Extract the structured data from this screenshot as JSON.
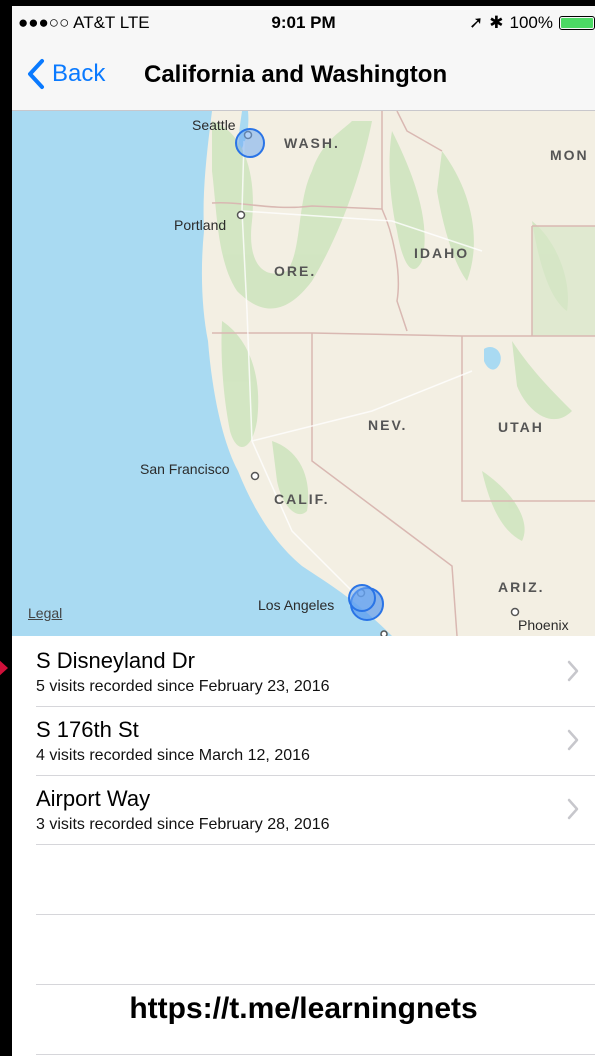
{
  "status_bar": {
    "carrier": "●●●○○ AT&T  LTE",
    "time": "9:01 PM",
    "battery": "100%",
    "battery_color": "#4cd964"
  },
  "nav": {
    "back_label": "Back",
    "title": "California and Washington",
    "accent": "#0a7aff"
  },
  "map": {
    "legal": "Legal",
    "cities": {
      "seattle": "Seattle",
      "portland": "Portland",
      "san_francisco": "San Francisco",
      "los_angeles": "Los Angeles",
      "phoenix": "Phoenix"
    },
    "states": {
      "wash": "WASH.",
      "ore": "ORE.",
      "idaho": "IDAHO",
      "mon": "MON",
      "nev": "NEV.",
      "utah": "UTAH",
      "calif": "CALIF.",
      "ariz": "ARIZ."
    }
  },
  "locations": [
    {
      "title": "S Disneyland Dr",
      "subtitle": "5 visits recorded since February 23, 2016"
    },
    {
      "title": "S 176th St",
      "subtitle": "4 visits recorded since March 12, 2016"
    },
    {
      "title": "Airport Way",
      "subtitle": "3 visits recorded since February 28, 2016"
    }
  ],
  "watermark": "https://t.me/learningnets"
}
